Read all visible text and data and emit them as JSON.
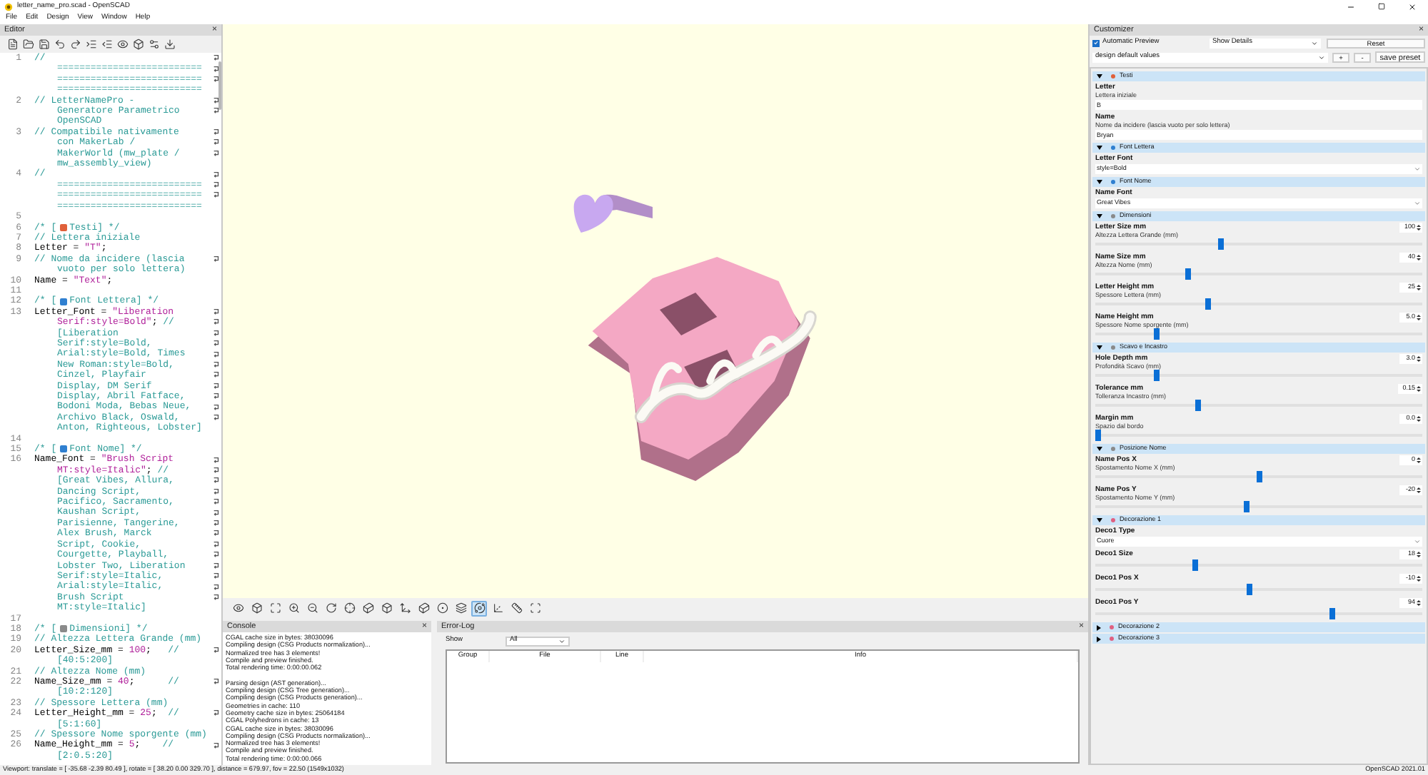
{
  "window": {
    "title": "letter_name_pro.scad - OpenSCAD"
  },
  "menu": [
    "File",
    "Edit",
    "Design",
    "View",
    "Window",
    "Help"
  ],
  "editor": {
    "title": "Editor",
    "close": "×",
    "lines": [
      {
        "number": "1",
        "wrapped": true,
        "parts": [
          {
            "kind": "comment",
            "text": "//"
          }
        ]
      },
      {
        "wrapped": true,
        "parts": [
          {
            "kind": "comment",
            "text": "=========================="
          }
        ]
      },
      {
        "wrapped": true,
        "parts": [
          {
            "kind": "comment",
            "text": "=========================="
          }
        ]
      },
      {
        "wrapped": false,
        "parts": [
          {
            "kind": "comment",
            "text": "=========================="
          }
        ]
      },
      {
        "number": "2",
        "wrapped": true,
        "parts": [
          {
            "kind": "comment",
            "text": "// LetterNamePro -"
          }
        ]
      },
      {
        "wrapped": true,
        "parts": [
          {
            "kind": "comment",
            "text": "Generatore Parametrico"
          }
        ]
      },
      {
        "wrapped": false,
        "parts": [
          {
            "kind": "comment",
            "text": "OpenSCAD"
          }
        ]
      },
      {
        "number": "3",
        "wrapped": true,
        "parts": [
          {
            "kind": "comment",
            "text": "// Compatibile nativamente"
          }
        ]
      },
      {
        "wrapped": true,
        "parts": [
          {
            "kind": "comment",
            "text": "con MakerLab /"
          }
        ]
      },
      {
        "wrapped": true,
        "parts": [
          {
            "kind": "comment",
            "text": "MakerWorld (mw_plate /"
          }
        ]
      },
      {
        "wrapped": false,
        "parts": [
          {
            "kind": "comment",
            "text": "mw_assembly_view)"
          }
        ]
      },
      {
        "number": "4",
        "wrapped": true,
        "parts": [
          {
            "kind": "comment",
            "text": "//"
          }
        ]
      },
      {
        "wrapped": true,
        "parts": [
          {
            "kind": "comment",
            "text": "=========================="
          }
        ]
      },
      {
        "wrapped": true,
        "parts": [
          {
            "kind": "comment",
            "text": "=========================="
          }
        ]
      },
      {
        "wrapped": false,
        "parts": [
          {
            "kind": "comment",
            "text": "=========================="
          }
        ]
      },
      {
        "number": "5",
        "wrapped": false
      },
      {
        "number": "6",
        "wrapped": false,
        "parts": [
          {
            "kind": "comment",
            "text": "/* ["
          },
          {
            "kind": "emoji",
            "color": "#e0603a"
          },
          {
            "kind": "comment",
            "text": "Testi] */"
          }
        ]
      },
      {
        "number": "7",
        "wrapped": false,
        "parts": [
          {
            "kind": "comment",
            "text": "// Lettera iniziale"
          }
        ]
      },
      {
        "number": "8",
        "wrapped": false,
        "parts": [
          {
            "kind": "code",
            "text": "Letter = "
          },
          {
            "kind": "string",
            "text": "\"T\""
          },
          {
            "kind": "code",
            "text": ";"
          }
        ]
      },
      {
        "number": "9",
        "wrapped": true,
        "parts": [
          {
            "kind": "comment",
            "text": "// Nome da incidere (lascia"
          }
        ]
      },
      {
        "wrapped": false,
        "parts": [
          {
            "kind": "comment",
            "text": "vuoto per solo lettera)"
          }
        ]
      },
      {
        "number": "10",
        "wrapped": false,
        "parts": [
          {
            "kind": "code",
            "text": "Name = "
          },
          {
            "kind": "string",
            "text": "\"Text\""
          },
          {
            "kind": "code",
            "text": ";"
          }
        ]
      },
      {
        "number": "11",
        "wrapped": false
      },
      {
        "number": "12",
        "wrapped": false,
        "parts": [
          {
            "kind": "comment",
            "text": "/* ["
          },
          {
            "kind": "emoji",
            "color": "#2f7fd0"
          },
          {
            "kind": "comment",
            "text": "Font Lettera] */"
          }
        ]
      },
      {
        "number": "13",
        "wrapped": true,
        "parts": [
          {
            "kind": "code",
            "text": "Letter_Font = "
          },
          {
            "kind": "string",
            "text": "\"Liberation"
          }
        ]
      },
      {
        "wrapped": true,
        "parts": [
          {
            "kind": "string",
            "text": "Serif:style=Bold\""
          },
          {
            "kind": "code",
            "text": "; "
          },
          {
            "kind": "comment",
            "text": "//"
          }
        ]
      },
      {
        "wrapped": true,
        "parts": [
          {
            "kind": "comment",
            "text": "[Liberation"
          }
        ]
      },
      {
        "wrapped": true,
        "parts": [
          {
            "kind": "comment",
            "text": "Serif:style=Bold,"
          }
        ]
      },
      {
        "wrapped": true,
        "parts": [
          {
            "kind": "comment",
            "text": "Arial:style=Bold, Times"
          }
        ]
      },
      {
        "wrapped": true,
        "parts": [
          {
            "kind": "comment",
            "text": "New Roman:style=Bold,"
          }
        ]
      },
      {
        "wrapped": true,
        "parts": [
          {
            "kind": "comment",
            "text": "Cinzel, Playfair"
          }
        ]
      },
      {
        "wrapped": true,
        "parts": [
          {
            "kind": "comment",
            "text": "Display, DM Serif"
          }
        ]
      },
      {
        "wrapped": true,
        "parts": [
          {
            "kind": "comment",
            "text": "Display, Abril Fatface,"
          }
        ]
      },
      {
        "wrapped": true,
        "parts": [
          {
            "kind": "comment",
            "text": "Bodoni Moda, Bebas Neue,"
          }
        ]
      },
      {
        "wrapped": true,
        "parts": [
          {
            "kind": "comment",
            "text": "Archivo Black, Oswald,"
          }
        ]
      },
      {
        "wrapped": false,
        "parts": [
          {
            "kind": "comment",
            "text": "Anton, Righteous, Lobster]"
          }
        ]
      },
      {
        "number": "14",
        "wrapped": false
      },
      {
        "number": "15",
        "wrapped": false,
        "parts": [
          {
            "kind": "comment",
            "text": "/* ["
          },
          {
            "kind": "emoji",
            "color": "#2f7fd0"
          },
          {
            "kind": "comment",
            "text": "Font Nome] */"
          }
        ]
      },
      {
        "number": "16",
        "wrapped": true,
        "parts": [
          {
            "kind": "code",
            "text": "Name_Font = "
          },
          {
            "kind": "string",
            "text": "\"Brush Script"
          }
        ]
      },
      {
        "wrapped": true,
        "parts": [
          {
            "kind": "string",
            "text": "MT:style=Italic\""
          },
          {
            "kind": "code",
            "text": "; "
          },
          {
            "kind": "comment",
            "text": "//"
          }
        ]
      },
      {
        "wrapped": true,
        "parts": [
          {
            "kind": "comment",
            "text": "[Great Vibes, Allura,"
          }
        ]
      },
      {
        "wrapped": true,
        "parts": [
          {
            "kind": "comment",
            "text": "Dancing Script,"
          }
        ]
      },
      {
        "wrapped": true,
        "parts": [
          {
            "kind": "comment",
            "text": "Pacifico, Sacramento,"
          }
        ]
      },
      {
        "wrapped": true,
        "parts": [
          {
            "kind": "comment",
            "text": "Kaushan Script,"
          }
        ]
      },
      {
        "wrapped": true,
        "parts": [
          {
            "kind": "comment",
            "text": "Parisienne, Tangerine,"
          }
        ]
      },
      {
        "wrapped": true,
        "parts": [
          {
            "kind": "comment",
            "text": "Alex Brush, Marck"
          }
        ]
      },
      {
        "wrapped": true,
        "parts": [
          {
            "kind": "comment",
            "text": "Script, Cookie,"
          }
        ]
      },
      {
        "wrapped": true,
        "parts": [
          {
            "kind": "comment",
            "text": "Courgette, Playball,"
          }
        ]
      },
      {
        "wrapped": true,
        "parts": [
          {
            "kind": "comment",
            "text": "Lobster Two, Liberation"
          }
        ]
      },
      {
        "wrapped": true,
        "parts": [
          {
            "kind": "comment",
            "text": "Serif:style=Italic,"
          }
        ]
      },
      {
        "wrapped": true,
        "parts": [
          {
            "kind": "comment",
            "text": "Arial:style=Italic,"
          }
        ]
      },
      {
        "wrapped": true,
        "parts": [
          {
            "kind": "comment",
            "text": "Brush Script"
          }
        ]
      },
      {
        "wrapped": false,
        "parts": [
          {
            "kind": "comment",
            "text": "MT:style=Italic]"
          }
        ]
      },
      {
        "number": "17",
        "wrapped": false
      },
      {
        "number": "18",
        "wrapped": false,
        "parts": [
          {
            "kind": "comment",
            "text": "/* ["
          },
          {
            "kind": "emoji",
            "color": "#8a8a8a"
          },
          {
            "kind": "comment",
            "text": "Dimensioni] */"
          }
        ]
      },
      {
        "number": "19",
        "wrapped": false,
        "parts": [
          {
            "kind": "comment",
            "text": "// Altezza Lettera Grande (mm)"
          }
        ]
      },
      {
        "number": "20",
        "wrapped": true,
        "parts": [
          {
            "kind": "code",
            "text": "Letter_Size_mm = "
          },
          {
            "kind": "number",
            "text": "100"
          },
          {
            "kind": "code",
            "text": ";   "
          },
          {
            "kind": "comment",
            "text": "//"
          }
        ]
      },
      {
        "wrapped": false,
        "parts": [
          {
            "kind": "comment",
            "text": "[40:5:200]"
          }
        ]
      },
      {
        "number": "21",
        "wrapped": false,
        "parts": [
          {
            "kind": "comment",
            "text": "// Altezza Nome (mm)"
          }
        ]
      },
      {
        "number": "22",
        "wrapped": true,
        "parts": [
          {
            "kind": "code",
            "text": "Name_Size_mm = "
          },
          {
            "kind": "number",
            "text": "40"
          },
          {
            "kind": "code",
            "text": ";      "
          },
          {
            "kind": "comment",
            "text": "//"
          }
        ]
      },
      {
        "wrapped": false,
        "parts": [
          {
            "kind": "comment",
            "text": "[10:2:120]"
          }
        ]
      },
      {
        "number": "23",
        "wrapped": false,
        "parts": [
          {
            "kind": "comment",
            "text": "// Spessore Lettera (mm)"
          }
        ]
      },
      {
        "number": "24",
        "wrapped": true,
        "parts": [
          {
            "kind": "code",
            "text": "Letter_Height_mm = "
          },
          {
            "kind": "number",
            "text": "25"
          },
          {
            "kind": "code",
            "text": ";  "
          },
          {
            "kind": "comment",
            "text": "//"
          }
        ]
      },
      {
        "wrapped": false,
        "parts": [
          {
            "kind": "comment",
            "text": "[5:1:60]"
          }
        ]
      },
      {
        "number": "25",
        "wrapped": false,
        "parts": [
          {
            "kind": "comment",
            "text": "// Spessore Nome sporgente (mm)"
          }
        ]
      },
      {
        "number": "26",
        "wrapped": true,
        "parts": [
          {
            "kind": "code",
            "text": "Name_Height_mm = "
          },
          {
            "kind": "number",
            "text": "5"
          },
          {
            "kind": "code",
            "text": ";    "
          },
          {
            "kind": "comment",
            "text": "//"
          }
        ]
      },
      {
        "wrapped": false,
        "parts": [
          {
            "kind": "comment",
            "text": "[2:0.5:20]"
          }
        ]
      }
    ]
  },
  "view_toolbar": [
    {
      "selected": false
    },
    {
      "selected": false
    },
    {
      "selected": false
    },
    {
      "selected": false
    },
    {
      "selected": false
    },
    {
      "selected": false
    },
    {
      "selected": false
    },
    {
      "selected": false
    },
    {
      "selected": false
    },
    {
      "selected": false
    },
    {
      "selected": false
    },
    {
      "selected": false
    },
    {
      "selected": false
    },
    {
      "selected": true
    },
    {
      "selected": false
    },
    {
      "selected": false
    },
    {
      "selected": false
    }
  ],
  "console": {
    "title": "Console",
    "close": "×",
    "blocks": [
      [
        "CGAL cache size in bytes: 38030096",
        "Compiling design (CSG Products normalization)...",
        "Normalized tree has 3 elements!",
        "Compile and preview finished.",
        "Total rendering time: 0:00:00.062"
      ],
      [
        "Parsing design (AST generation)...",
        "Compiling design (CSG Tree generation)...",
        "Compiling design (CSG Products generation)...",
        "Geometries in cache: 110",
        "Geometry cache size in bytes: 25064184",
        "CGAL Polyhedrons in cache: 13",
        "CGAL cache size in bytes: 38030096",
        "Compiling design (CSG Products normalization)...",
        "Normalized tree has 3 elements!",
        "Compile and preview finished.",
        "Total rendering time: 0:00:00.066"
      ]
    ]
  },
  "error_log": {
    "title": "Error-Log",
    "close": "×",
    "show_label": "Show",
    "show_value": "All",
    "columns": [
      "Group",
      "File",
      "Line",
      "Info"
    ]
  },
  "customizer": {
    "title": "Customizer",
    "close": "×",
    "automatic_preview": {
      "label": "Automatic Preview",
      "checked": true
    },
    "details": "Show Details",
    "reset": "Reset",
    "preset": "design default values",
    "add": "+",
    "remove": "-",
    "save": "save preset",
    "sections": [
      {
        "title": "Testi",
        "color": "#e0603a",
        "expanded": true,
        "items": [
          {
            "kind": "text",
            "name": "Letter",
            "description": "Lettera iniziale",
            "value": "B"
          },
          {
            "kind": "text",
            "name": "Name",
            "description": "Nome da incidere (lascia vuoto per solo lettera)",
            "value": "Bryan"
          }
        ]
      },
      {
        "title": "Font Lettera",
        "color": "#2f7fd0",
        "expanded": true,
        "items": [
          {
            "kind": "select",
            "name": "Letter Font",
            "value": "style=Bold"
          }
        ]
      },
      {
        "title": "Font Nome",
        "color": "#2f7fd0",
        "expanded": true,
        "items": [
          {
            "kind": "select",
            "name": "Name Font",
            "value": "Great Vibes"
          }
        ]
      },
      {
        "title": "Dimensioni",
        "color": "#8a8a8a",
        "expanded": true,
        "items": [
          {
            "kind": "slider",
            "name": "Letter Size mm",
            "description": "Altezza Lettera Grande (mm)",
            "value": "100",
            "level": 0.38
          },
          {
            "kind": "slider",
            "name": "Name Size mm",
            "description": "Altezza Nome (mm)",
            "value": "40",
            "level": 0.28
          },
          {
            "kind": "slider",
            "name": "Letter Height mm",
            "description": "Spessore Lettera (mm)",
            "value": "25",
            "level": 0.34
          },
          {
            "kind": "slider",
            "name": "Name Height mm",
            "description": "Spessore Nome sporgente (mm)",
            "value": "5.0",
            "level": 0.18
          }
        ]
      },
      {
        "title": "Scavo e Incastro",
        "color": "#8a8a8a",
        "expanded": true,
        "items": [
          {
            "kind": "slider",
            "name": "Hole Depth mm",
            "description": "Profondità Scavo (mm)",
            "value": "3.0",
            "level": 0.18
          },
          {
            "kind": "slider",
            "name": "Tolerance mm",
            "description": "Tolleranza Incastro (mm)",
            "value": "0.15",
            "level": 0.31
          },
          {
            "kind": "slider",
            "name": "Margin mm",
            "description": "Spazio dal bordo",
            "value": "0.0",
            "level": 0.0
          }
        ]
      },
      {
        "title": "Posizione Nome",
        "color": "#8a8a8a",
        "expanded": true,
        "items": [
          {
            "kind": "slider",
            "name": "Name Pos X",
            "description": "Spostamento Nome X (mm)",
            "value": "0",
            "level": 0.5
          },
          {
            "kind": "slider",
            "name": "Name Pos Y",
            "description": "Spostamento Nome Y (mm)",
            "value": "-20",
            "level": 0.46
          }
        ]
      },
      {
        "title": "Decorazione 1",
        "color": "#e06080",
        "expanded": true,
        "items": [
          {
            "kind": "select",
            "name": "Deco1 Type",
            "value": "Cuore"
          },
          {
            "kind": "slider",
            "name": "Deco1 Size",
            "value": "18",
            "level": 0.3
          },
          {
            "kind": "slider",
            "name": "Deco1 Pos X",
            "value": "-10",
            "level": 0.47
          },
          {
            "kind": "slider",
            "name": "Deco1 Pos Y",
            "value": "94",
            "level": 0.73
          }
        ]
      },
      {
        "title": "Decorazione 2",
        "color": "#e06080",
        "expanded": false
      },
      {
        "title": "Decorazione 3",
        "color": "#e06080",
        "expanded": false
      }
    ]
  },
  "status_bar": {
    "viewport": "Viewport: translate = [ -35.68 -2.39 80.49 ], rotate = [ 38.20 0.00 329.70 ], distance = 679.97, fov = 22.50 (1549x1032)",
    "version": "OpenSCAD 2021.01"
  }
}
